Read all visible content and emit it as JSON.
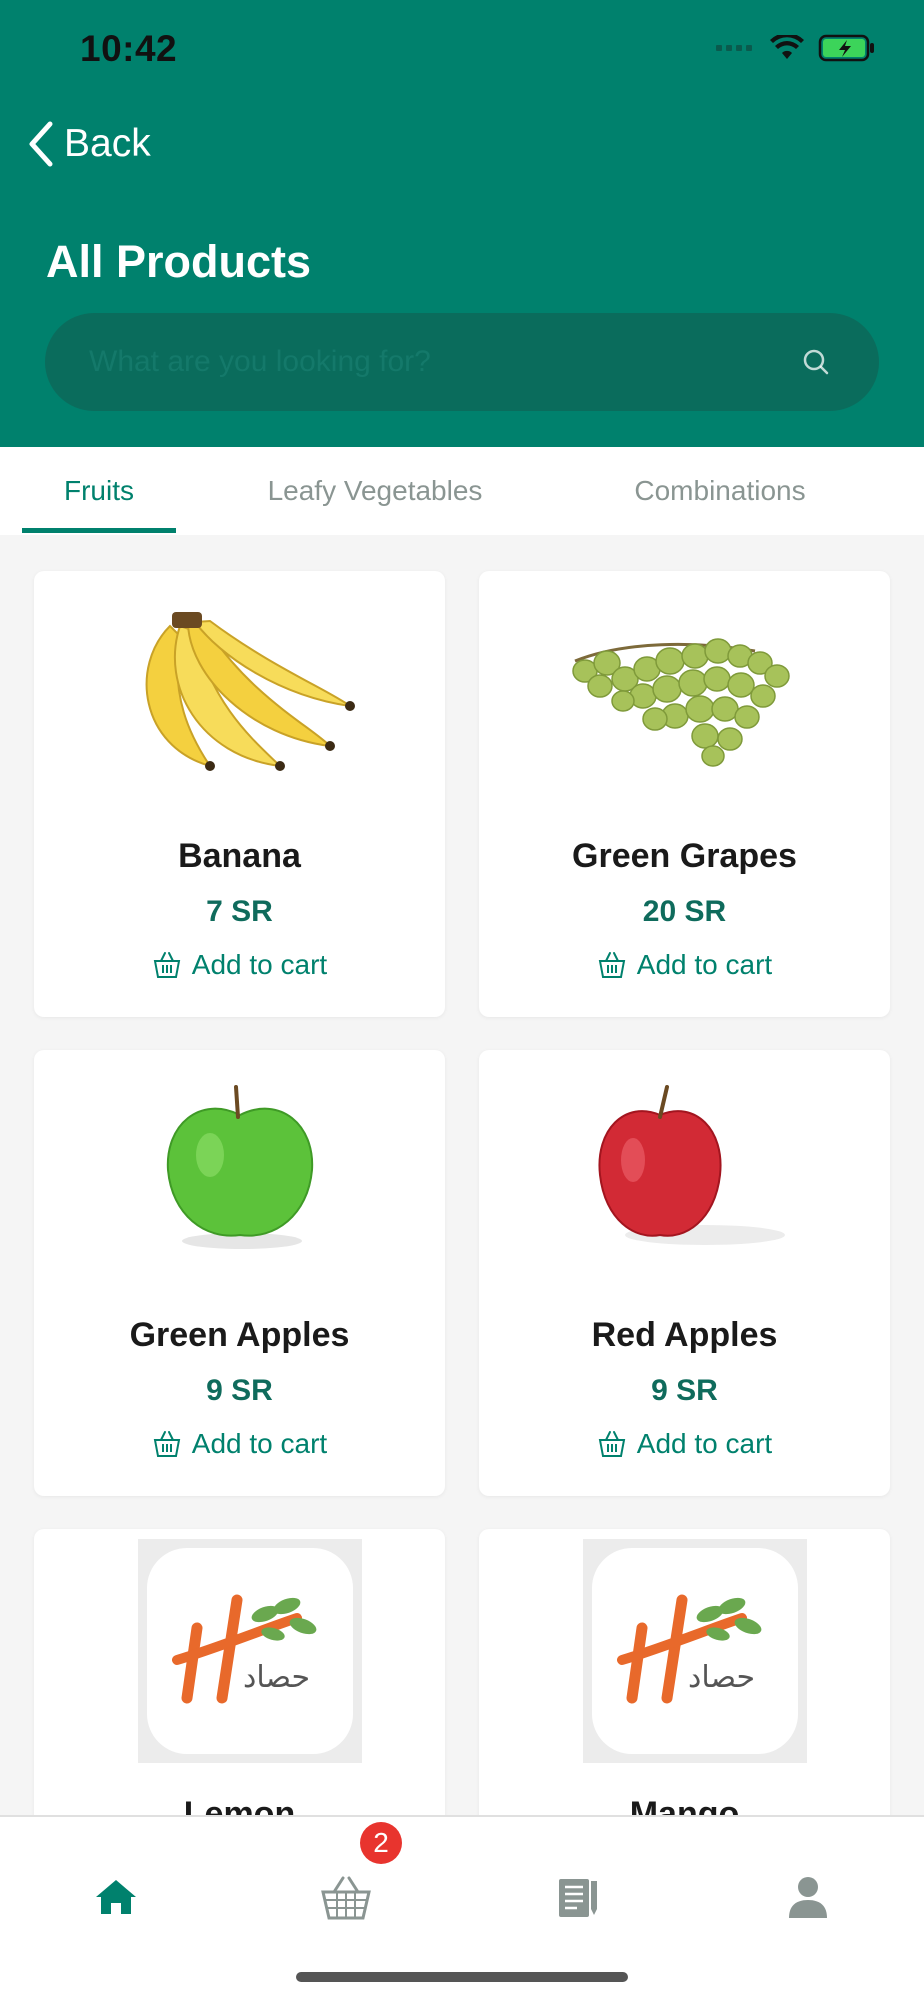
{
  "status_bar": {
    "time": "10:42"
  },
  "header": {
    "back_label": "Back",
    "title": "All Products",
    "search_placeholder": "What are you looking for?"
  },
  "tabs": [
    {
      "label": "Fruits",
      "active": true
    },
    {
      "label": "Leafy Vegetables",
      "active": false
    },
    {
      "label": "Combinations",
      "active": false
    }
  ],
  "products": [
    {
      "name": "Banana",
      "price": "7 SR",
      "add_label": "Add to cart",
      "image": "banana"
    },
    {
      "name": "Green Grapes",
      "price": "20 SR",
      "add_label": "Add to cart",
      "image": "green-grapes"
    },
    {
      "name": "Green Apples",
      "price": "9 SR",
      "add_label": "Add to cart",
      "image": "green-apple"
    },
    {
      "name": "Red Apples",
      "price": "9 SR",
      "add_label": "Add to cart",
      "image": "red-apple"
    },
    {
      "name": "Lemon",
      "price": "",
      "add_label": "",
      "image": "store-logo"
    },
    {
      "name": "Mango",
      "price": "",
      "add_label": "",
      "image": "store-logo"
    }
  ],
  "logo_text": "حصاد",
  "bottom_nav": {
    "items": [
      "home-icon",
      "basket-icon",
      "menu-icon",
      "profile-icon"
    ],
    "cart_badge": "2"
  },
  "colors": {
    "primary": "#00816d",
    "badge": "#e8342e"
  }
}
